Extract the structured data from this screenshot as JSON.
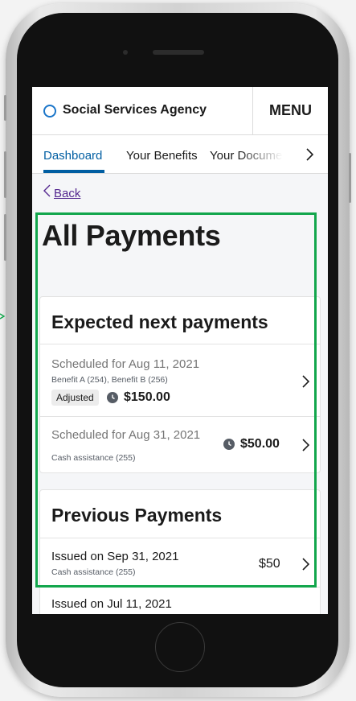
{
  "header": {
    "agency_name": "Social Services Agency",
    "menu_label": "MENU"
  },
  "tabs": [
    {
      "label": "Dashboard",
      "active": true
    },
    {
      "label": "Your Benefits",
      "active": false
    },
    {
      "label": "Your Documents",
      "active": false
    }
  ],
  "nav": {
    "back_label": "Back"
  },
  "page": {
    "title": "All Payments"
  },
  "expected": {
    "heading": "Expected next payments",
    "items": [
      {
        "date": "Scheduled for Aug 11, 2021",
        "details": "Benefit A (254), Benefit B (256)",
        "badge": "Adjusted",
        "amount": "$150.00"
      },
      {
        "date": "Scheduled for Aug 31, 2021",
        "details": "Cash assistance (255)",
        "amount": "$50.00"
      }
    ]
  },
  "previous": {
    "heading": "Previous Payments",
    "items": [
      {
        "date": "Issued on Sep 31, 2021",
        "details": "Cash assistance (255)",
        "amount": "$50"
      },
      {
        "date": "Issued on Jul 11, 2021"
      }
    ]
  },
  "colors": {
    "accent": "#005ea2",
    "link_visited": "#54278f",
    "highlight": "#12a64c",
    "logo": "#1a75c9"
  }
}
